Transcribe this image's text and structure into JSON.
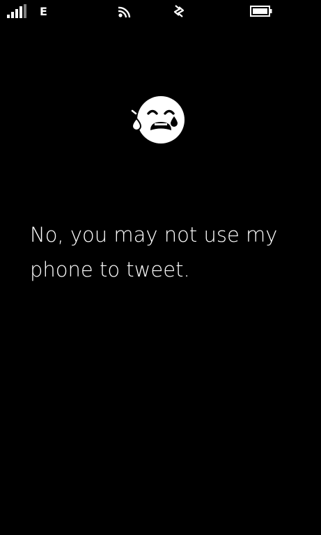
{
  "status_bar": {
    "network_type": "E",
    "icons": {
      "signal": "signal-strength-icon",
      "wifi": "wifi-icon",
      "nfc": "nfc-icon",
      "battery": "battery-icon"
    },
    "signal_bars_active": 4,
    "signal_bars_total": 5
  },
  "emoji": {
    "icon": "crying-face-icon"
  },
  "message": {
    "text": "No, you may not use my phone to tweet."
  },
  "colors": {
    "background": "#000000",
    "foreground": "#ffffff",
    "inactive": "#808080"
  }
}
